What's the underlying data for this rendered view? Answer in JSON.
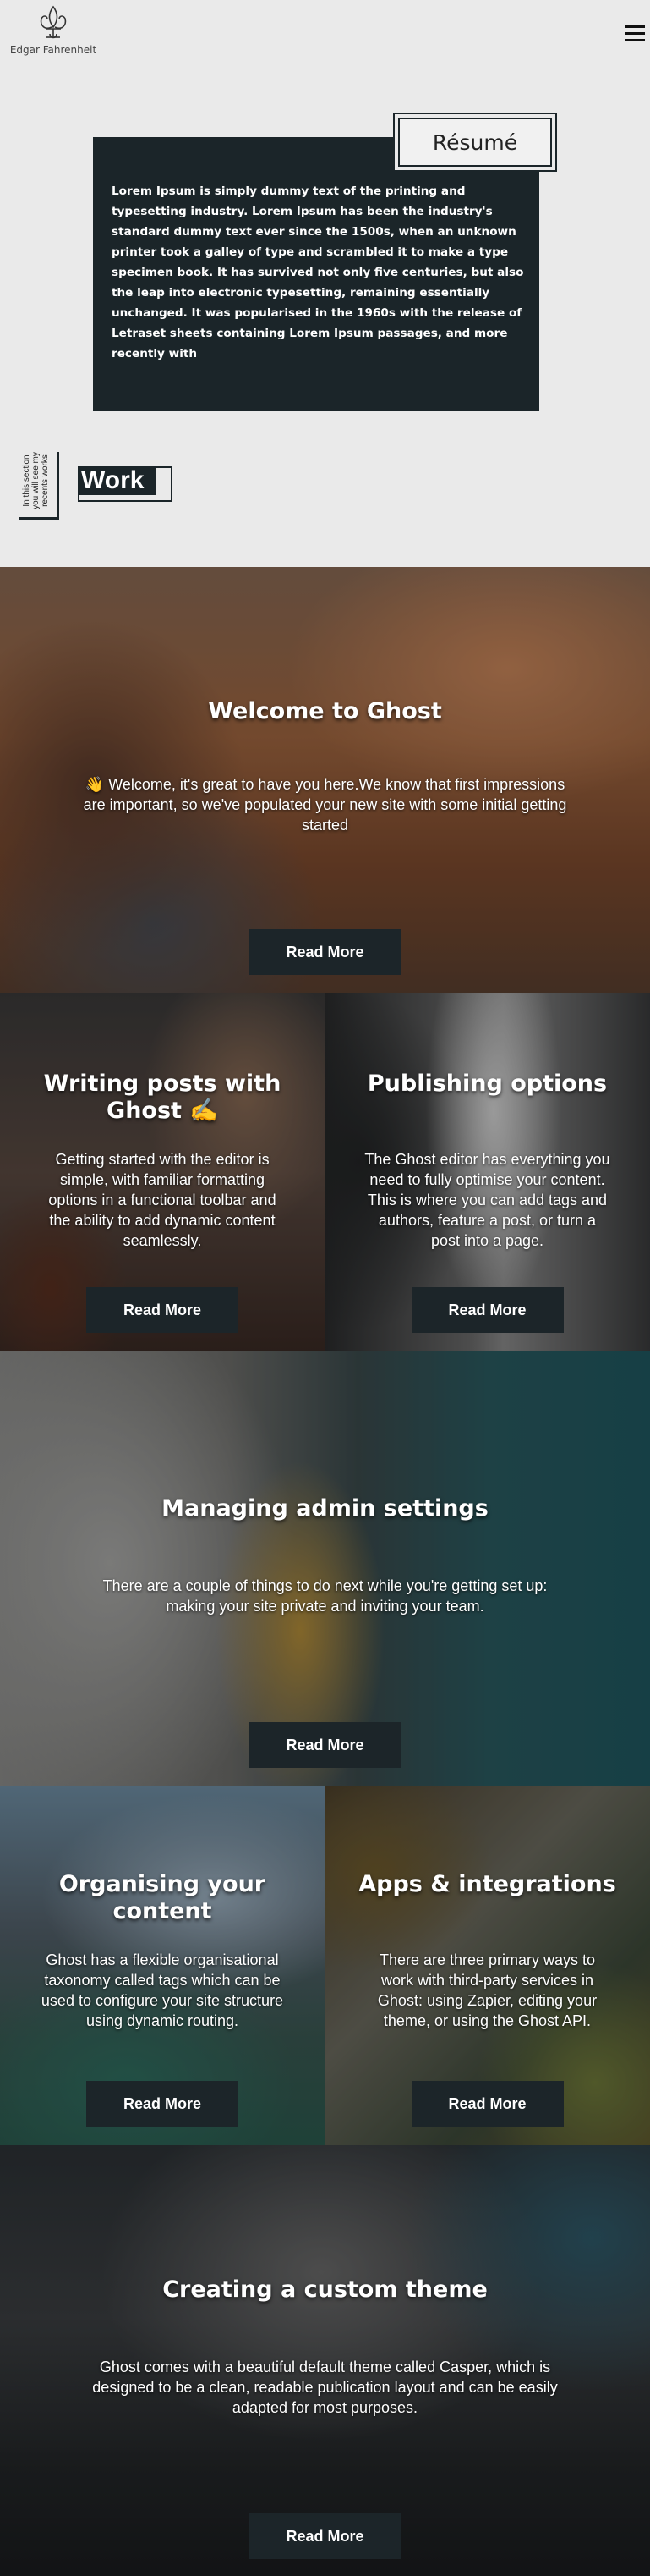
{
  "header": {
    "logo_text": "Edgar Fahrenheit",
    "logo_icon": "fleur-de-lis-icon",
    "menu_icon": "hamburger-menu-icon"
  },
  "resume": {
    "title": "Résumé",
    "text": "Lorem Ipsum is simply dummy text of the printing and typesetting industry. Lorem Ipsum has been the industry's standard dummy text ever since the 1500s, when an unknown printer took a galley of type and scrambled it to make a type specimen book. It has survived not only five centuries, but also the leap into electronic typesetting, remaining essentially unchanged. It was popularised in the 1960s with the release of Letraset sheets containing Lorem Ipsum passages, and more recently with"
  },
  "work": {
    "vertical_text": "In this section you will see my recents works",
    "label": "Work"
  },
  "posts": [
    {
      "title": "Welcome to Ghost",
      "excerpt": "👋 Welcome, it's great to have you here.We know that first impressions are important, so we've populated your new site with some initial getting started",
      "button": "Read More"
    },
    {
      "title": "Writing posts with Ghost ✍️",
      "excerpt": "Getting started with the editor is simple, with familiar formatting options in a functional toolbar and the ability to add dynamic content seamlessly.",
      "button": "Read More"
    },
    {
      "title": "Publishing options",
      "excerpt": "The Ghost editor has everything you need to fully optimise your content. This is where you can add tags and authors, feature a post, or turn a post into a page.",
      "button": "Read More"
    },
    {
      "title": "Managing admin settings",
      "excerpt": "There are a couple of things to do next while you're getting set up: making your site private and inviting your team.",
      "button": "Read More"
    },
    {
      "title": "Organising your content",
      "excerpt": "Ghost has a flexible organisational taxonomy called tags which can be used to configure your site structure using dynamic routing.",
      "button": "Read More"
    },
    {
      "title": "Apps & integrations",
      "excerpt": "There are three primary ways to work with third-party services in Ghost: using Zapier, editing your theme, or using the Ghost API.",
      "button": "Read More"
    },
    {
      "title": "Creating a custom theme",
      "excerpt": "Ghost comes with a beautiful default theme called Casper, which is designed to be a clean, readable publication layout and can be easily adapted for most purposes.",
      "button": "Read More"
    }
  ],
  "colors": {
    "background": "#eaeaea",
    "dark": "#1b2529",
    "button": "#1c2529"
  }
}
